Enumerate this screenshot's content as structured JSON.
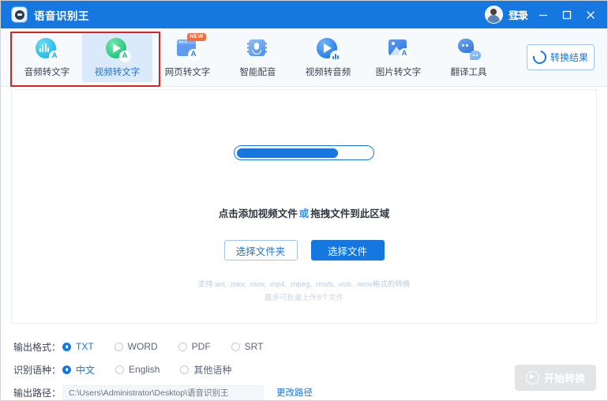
{
  "window": {
    "app_title": "语音识别王",
    "logo_icon": "app-logo-icon",
    "login_label": "登录",
    "avatar_icon": "user-avatar-icon",
    "menu_icon": "hamburger-menu-icon",
    "minimize_icon": "minimize-icon",
    "maximize_icon": "maximize-icon",
    "close_icon": "close-icon",
    "titlebar_color": "#1577e0"
  },
  "toolbar": {
    "tabs": [
      {
        "label": "音频转文字",
        "icon": "audio-to-text-icon",
        "selected": false,
        "badge": ""
      },
      {
        "label": "视频转文字",
        "icon": "video-to-text-icon",
        "selected": true,
        "badge": ""
      },
      {
        "label": "网页转文字",
        "icon": "webpage-to-text-icon",
        "selected": false,
        "badge": "NEW"
      },
      {
        "label": "智能配音",
        "icon": "smart-dubbing-icon",
        "selected": false,
        "badge": ""
      },
      {
        "label": "视频转音频",
        "icon": "video-to-audio-icon",
        "selected": false,
        "badge": ""
      },
      {
        "label": "图片转文字",
        "icon": "image-to-text-icon",
        "selected": false,
        "badge": ""
      },
      {
        "label": "翻译工具",
        "icon": "translate-tool-icon",
        "selected": false,
        "badge": ""
      }
    ],
    "result_button": {
      "label": "转换结果",
      "icon": "refresh-icon"
    },
    "annotation_color": "#e02020"
  },
  "dropzone": {
    "progress_percent": 75,
    "hint_prefix": "点击添加视频文件",
    "hint_or": "或",
    "hint_suffix": "拖拽文件到此区域",
    "select_folder_label": "选择文件夹",
    "select_file_label": "选择文件",
    "support_formats": "支持.avi, .mkv, .mov, .mp4, .mpeg, .rmvb, .vob, .wmv格式的转换",
    "support_limit": "最多可批量上传8个文件"
  },
  "options": {
    "output_format_label": "输出格式：",
    "output_formats": [
      {
        "label": "TXT",
        "selected": true
      },
      {
        "label": "WORD",
        "selected": false
      },
      {
        "label": "PDF",
        "selected": false
      },
      {
        "label": "SRT",
        "selected": false
      }
    ],
    "language_label": "识别语种：",
    "languages": [
      {
        "label": "中文",
        "selected": true
      },
      {
        "label": "English",
        "selected": false
      },
      {
        "label": "其他语种",
        "selected": false
      }
    ],
    "output_path_label": "输出路径：",
    "output_path_value": "C:\\Users\\Administrator\\Desktop\\语音识别王",
    "change_path_label": "更改路径"
  },
  "footer": {
    "start_button_label": "开始转换",
    "start_button_icon": "play-circle-icon",
    "start_button_disabled": true
  }
}
